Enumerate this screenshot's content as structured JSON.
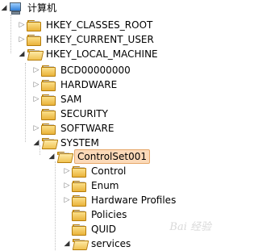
{
  "root": {
    "label": "计算机",
    "icon": "computer-icon"
  },
  "top_keys": [
    {
      "label": "HKEY_CLASSES_ROOT",
      "state": "collapsed"
    },
    {
      "label": "HKEY_CURRENT_USER",
      "state": "collapsed"
    },
    {
      "label": "HKEY_LOCAL_MACHINE",
      "state": "expanded"
    }
  ],
  "hklm_children": [
    {
      "label": "BCD00000000",
      "state": "collapsed"
    },
    {
      "label": "HARDWARE",
      "state": "collapsed"
    },
    {
      "label": "SAM",
      "state": "collapsed"
    },
    {
      "label": "SECURITY",
      "state": "none"
    },
    {
      "label": "SOFTWARE",
      "state": "collapsed"
    },
    {
      "label": "SYSTEM",
      "state": "expanded"
    }
  ],
  "system_children": [
    {
      "label": "ControlSet001",
      "state": "expanded",
      "selected": true
    }
  ],
  "controlset_children": [
    {
      "label": "Control",
      "state": "collapsed"
    },
    {
      "label": "Enum",
      "state": "collapsed"
    },
    {
      "label": "Hardware Profiles",
      "state": "collapsed"
    },
    {
      "label": "Policies",
      "state": "none"
    },
    {
      "label": "QUID",
      "state": "none"
    },
    {
      "label": "services",
      "state": "expanded"
    }
  ],
  "watermark": "Bai 经验",
  "colors": {
    "selection_bg": "#fbd9b8",
    "selection_border": "#e6a86a",
    "folder": "#eab33a"
  }
}
